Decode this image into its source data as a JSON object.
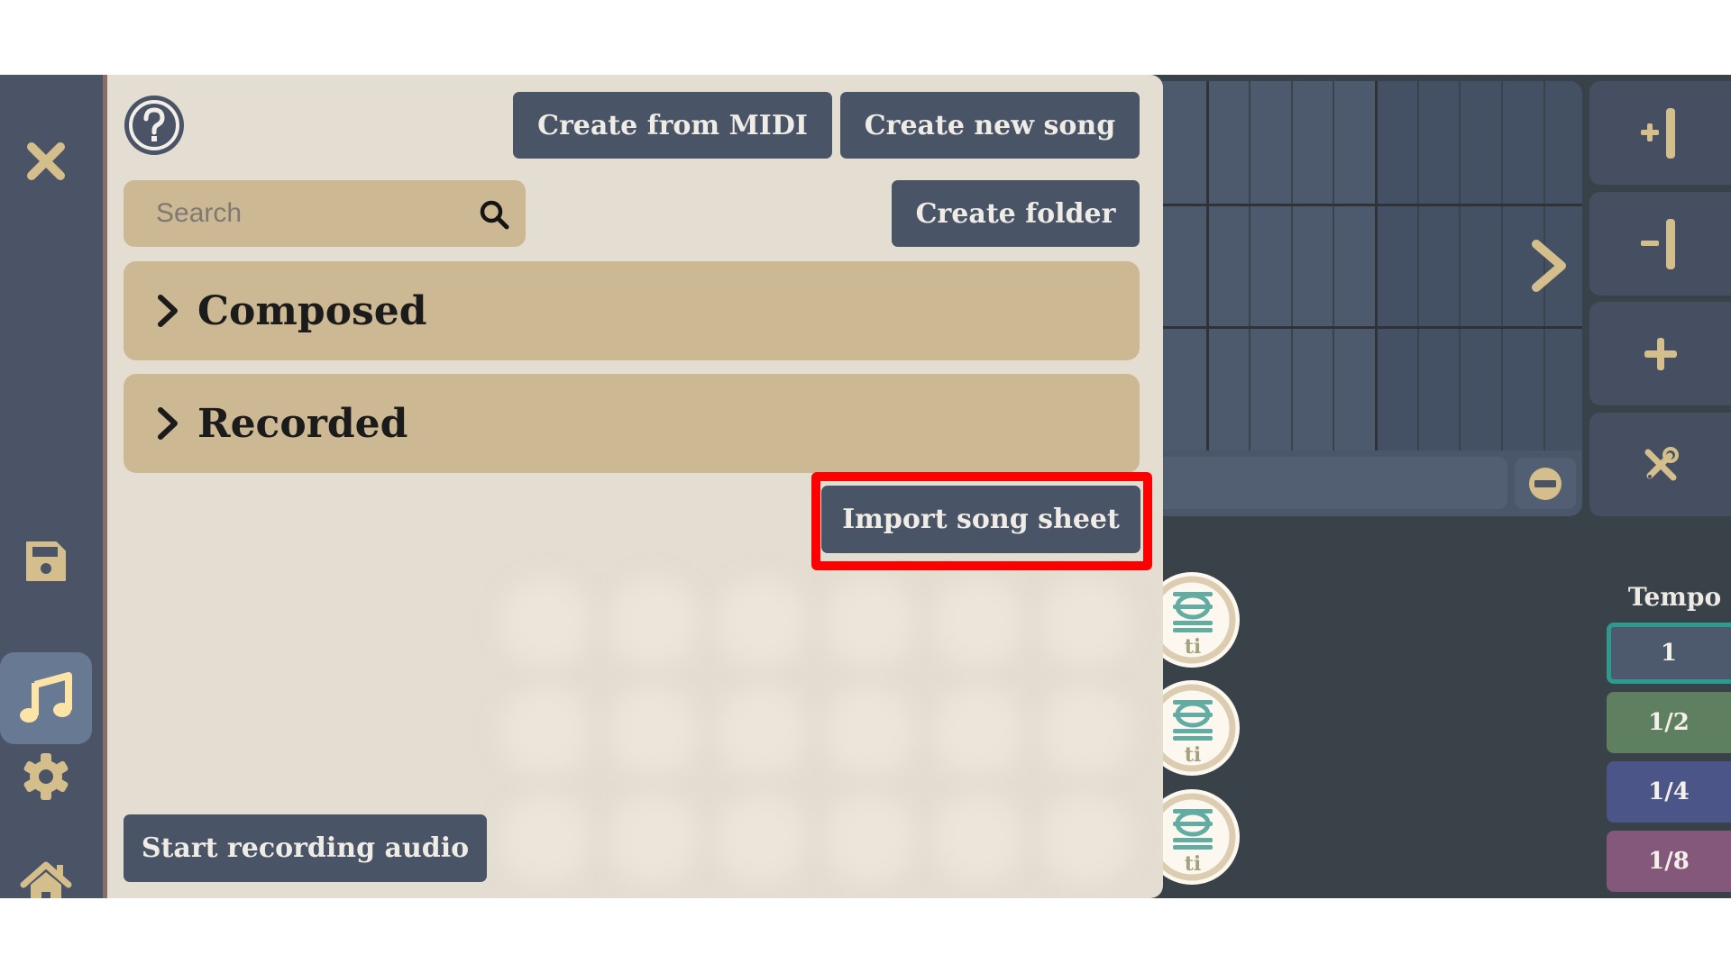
{
  "sidebar": {
    "items": [
      {
        "id": "close",
        "icon": "close-icon",
        "active": false
      },
      {
        "id": "save",
        "icon": "save-icon",
        "active": false
      },
      {
        "id": "songs",
        "icon": "music-note-icon",
        "active": true
      },
      {
        "id": "settings",
        "icon": "gear-icon",
        "active": false
      },
      {
        "id": "home",
        "icon": "home-icon",
        "active": false
      }
    ]
  },
  "song_menu": {
    "help_icon": "help-icon",
    "create_from_midi_label": "Create from MIDI",
    "create_new_song_label": "Create new song",
    "search": {
      "placeholder": "Search",
      "value": ""
    },
    "create_folder_label": "Create folder",
    "folders": [
      {
        "label": "Composed",
        "expanded": false
      },
      {
        "label": "Recorded",
        "expanded": false
      }
    ],
    "import_song_sheet_label": "Import song sheet",
    "start_recording_label": "Start recording audio"
  },
  "composer": {
    "tools": [
      {
        "id": "add-column",
        "icon": "add-column-icon"
      },
      {
        "id": "remove-column",
        "icon": "remove-column-icon"
      },
      {
        "id": "add",
        "icon": "plus-icon"
      },
      {
        "id": "tools",
        "icon": "tools-icon"
      }
    ],
    "note_buttons": [
      {
        "label": "ti"
      },
      {
        "label": "ti"
      },
      {
        "label": "ti"
      }
    ],
    "tempo": {
      "label": "Tempo",
      "options": [
        {
          "label": "1",
          "selected": true,
          "color": "#4d5a6e"
        },
        {
          "label": "1/2",
          "selected": false,
          "color": "#5e8060"
        },
        {
          "label": "1/4",
          "selected": false,
          "color": "#4b5588"
        },
        {
          "label": "1/8",
          "selected": false,
          "color": "#83587a"
        }
      ],
      "selected_border_color": "#2e9a8f"
    }
  },
  "colors": {
    "accent": "#d4be8c",
    "panel_bg": "#e4ddd1",
    "button_bg": "#4a5467",
    "folder_bg": "#cdb894",
    "highlight": "#ff0000"
  }
}
